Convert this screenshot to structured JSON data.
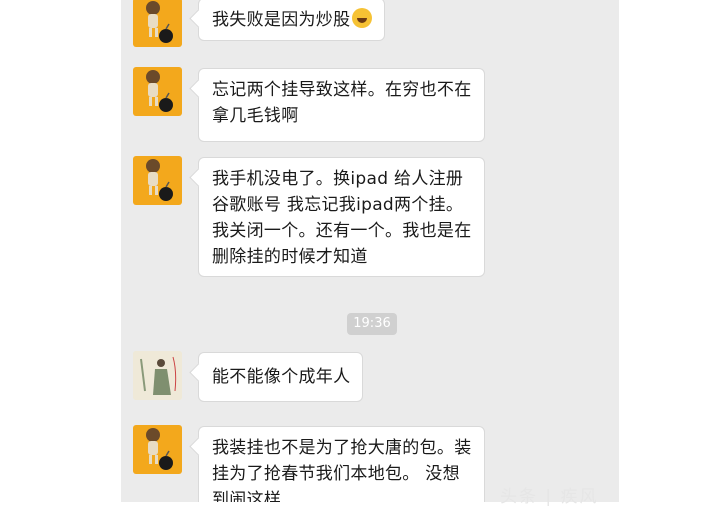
{
  "messages": [
    {
      "avatar": "monk-bomb-avatar",
      "lines": [
        "我失败是因为炒股"
      ],
      "emoji": "laughing-crying-emoji"
    },
    {
      "avatar": "monk-bomb-avatar",
      "lines": [
        "忘记两个挂导致这样。在穷也不在",
        "拿几毛钱啊"
      ]
    },
    {
      "avatar": "monk-bomb-avatar",
      "lines": [
        "我手机没电了。换ipad 给人注册",
        "谷歌账号 我忘记我ipad两个挂。",
        "我关闭一个。还有一个。我也是在",
        "删除挂的时候才知道"
      ]
    },
    {
      "avatar": "painting-figure-avatar",
      "lines": [
        "能不能像个成年人"
      ]
    },
    {
      "avatar": "monk-bomb-avatar",
      "lines": [
        "我装挂也不是为了抢大唐的包。装",
        "挂为了抢春节我们本地包。 没想",
        "到闹这样"
      ]
    }
  ],
  "timestamp": "19:36",
  "watermark": "头条 | 疾风"
}
